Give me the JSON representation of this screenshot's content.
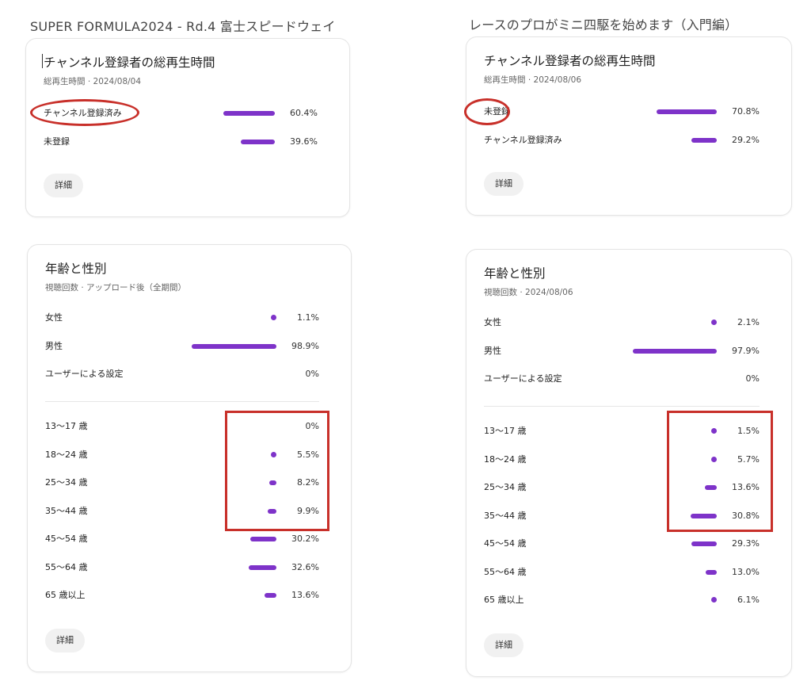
{
  "left": {
    "heading": "SUPER FORMULA2024 - Rd.4 富士スピードウェイ",
    "subscribers": {
      "title": "チャンネル登録者の総再生時間",
      "subtitle": "総再生時間 · 2024/08/04",
      "rows": [
        {
          "label": "チャンネル登録済み",
          "pct": "60.4%",
          "value": 60.4
        },
        {
          "label": "未登録",
          "pct": "39.6%",
          "value": 39.6
        }
      ],
      "details": "詳細"
    },
    "age_gender": {
      "title": "年齢と性別",
      "subtitle": "視聴回数 · アップロード後（全期間）",
      "gender_rows": [
        {
          "label": "女性",
          "pct": "1.1%",
          "value": 1.1
        },
        {
          "label": "男性",
          "pct": "98.9%",
          "value": 98.9
        },
        {
          "label": "ユーザーによる設定",
          "pct": "0%",
          "value": 0
        }
      ],
      "age_rows": [
        {
          "label": "13〜17 歳",
          "pct": "0%",
          "value": 0
        },
        {
          "label": "18〜24 歳",
          "pct": "5.5%",
          "value": 5.5
        },
        {
          "label": "25〜34 歳",
          "pct": "8.2%",
          "value": 8.2
        },
        {
          "label": "35〜44 歳",
          "pct": "9.9%",
          "value": 9.9
        },
        {
          "label": "45〜54 歳",
          "pct": "30.2%",
          "value": 30.2
        },
        {
          "label": "55〜64 歳",
          "pct": "32.6%",
          "value": 32.6
        },
        {
          "label": "65 歳以上",
          "pct": "13.6%",
          "value": 13.6
        }
      ],
      "details": "詳細"
    }
  },
  "right": {
    "heading": "レースのプロがミニ四駆を始めます（入門編）",
    "subscribers": {
      "title": "チャンネル登録者の総再生時間",
      "subtitle": "総再生時間 · 2024/08/06",
      "rows": [
        {
          "label": "未登録",
          "pct": "70.8%",
          "value": 70.8
        },
        {
          "label": "チャンネル登録済み",
          "pct": "29.2%",
          "value": 29.2
        }
      ],
      "details": "詳細"
    },
    "age_gender": {
      "title": "年齢と性別",
      "subtitle": "視聴回数 · 2024/08/06",
      "gender_rows": [
        {
          "label": "女性",
          "pct": "2.1%",
          "value": 2.1
        },
        {
          "label": "男性",
          "pct": "97.9%",
          "value": 97.9
        },
        {
          "label": "ユーザーによる設定",
          "pct": "0%",
          "value": 0
        }
      ],
      "age_rows": [
        {
          "label": "13〜17 歳",
          "pct": "1.5%",
          "value": 1.5
        },
        {
          "label": "18〜24 歳",
          "pct": "5.7%",
          "value": 5.7
        },
        {
          "label": "25〜34 歳",
          "pct": "13.6%",
          "value": 13.6
        },
        {
          "label": "35〜44 歳",
          "pct": "30.8%",
          "value": 30.8
        },
        {
          "label": "45〜54 歳",
          "pct": "29.3%",
          "value": 29.3
        },
        {
          "label": "55〜64 歳",
          "pct": "13.0%",
          "value": 13.0
        },
        {
          "label": "65 歳以上",
          "pct": "6.1%",
          "value": 6.1
        }
      ],
      "details": "詳細"
    }
  },
  "colors": {
    "bar": "#7e33c9",
    "annotation": "#c8302a"
  }
}
